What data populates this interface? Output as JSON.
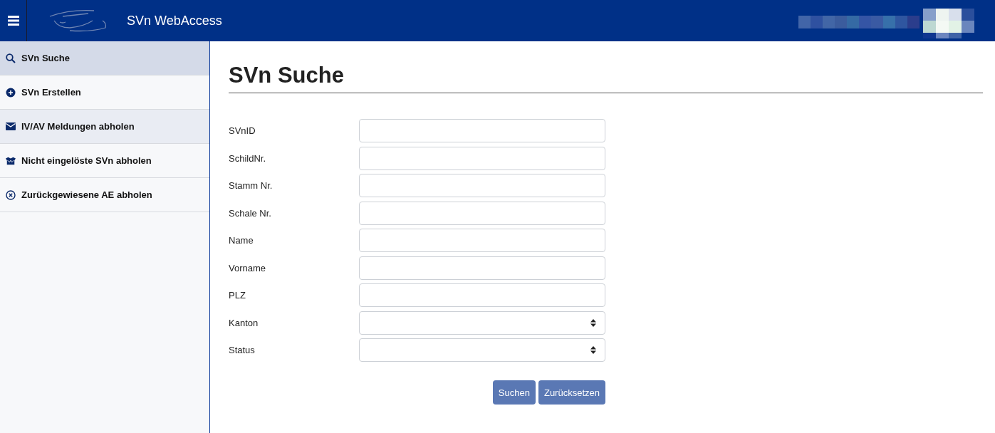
{
  "header": {
    "title": "SVn WebAccess"
  },
  "sidebar": {
    "items": [
      {
        "label": "SVn Suche",
        "selected": true,
        "hovered": false
      },
      {
        "label": "SVn Erstellen",
        "selected": false,
        "hovered": false
      },
      {
        "label": "IV/AV Meldungen abholen",
        "selected": false,
        "hovered": true
      },
      {
        "label": "Nicht eingelöste SVn abholen",
        "selected": false,
        "hovered": false
      },
      {
        "label": "Zurückgewiesene AE abholen",
        "selected": false,
        "hovered": false
      }
    ]
  },
  "main": {
    "heading": "SVn Suche",
    "fields": [
      {
        "label": "SVnID",
        "kind": "text"
      },
      {
        "label": "SchildNr.",
        "kind": "text"
      },
      {
        "label": "Stamm Nr.",
        "kind": "text"
      },
      {
        "label": "Schale Nr.",
        "kind": "text"
      },
      {
        "label": "Name",
        "kind": "text"
      },
      {
        "label": "Vorname",
        "kind": "text"
      },
      {
        "label": "PLZ",
        "kind": "text"
      },
      {
        "label": "Kanton",
        "kind": "select"
      },
      {
        "label": "Status",
        "kind": "select"
      }
    ],
    "buttons": [
      "Suchen",
      "Zurücksetzen"
    ]
  }
}
